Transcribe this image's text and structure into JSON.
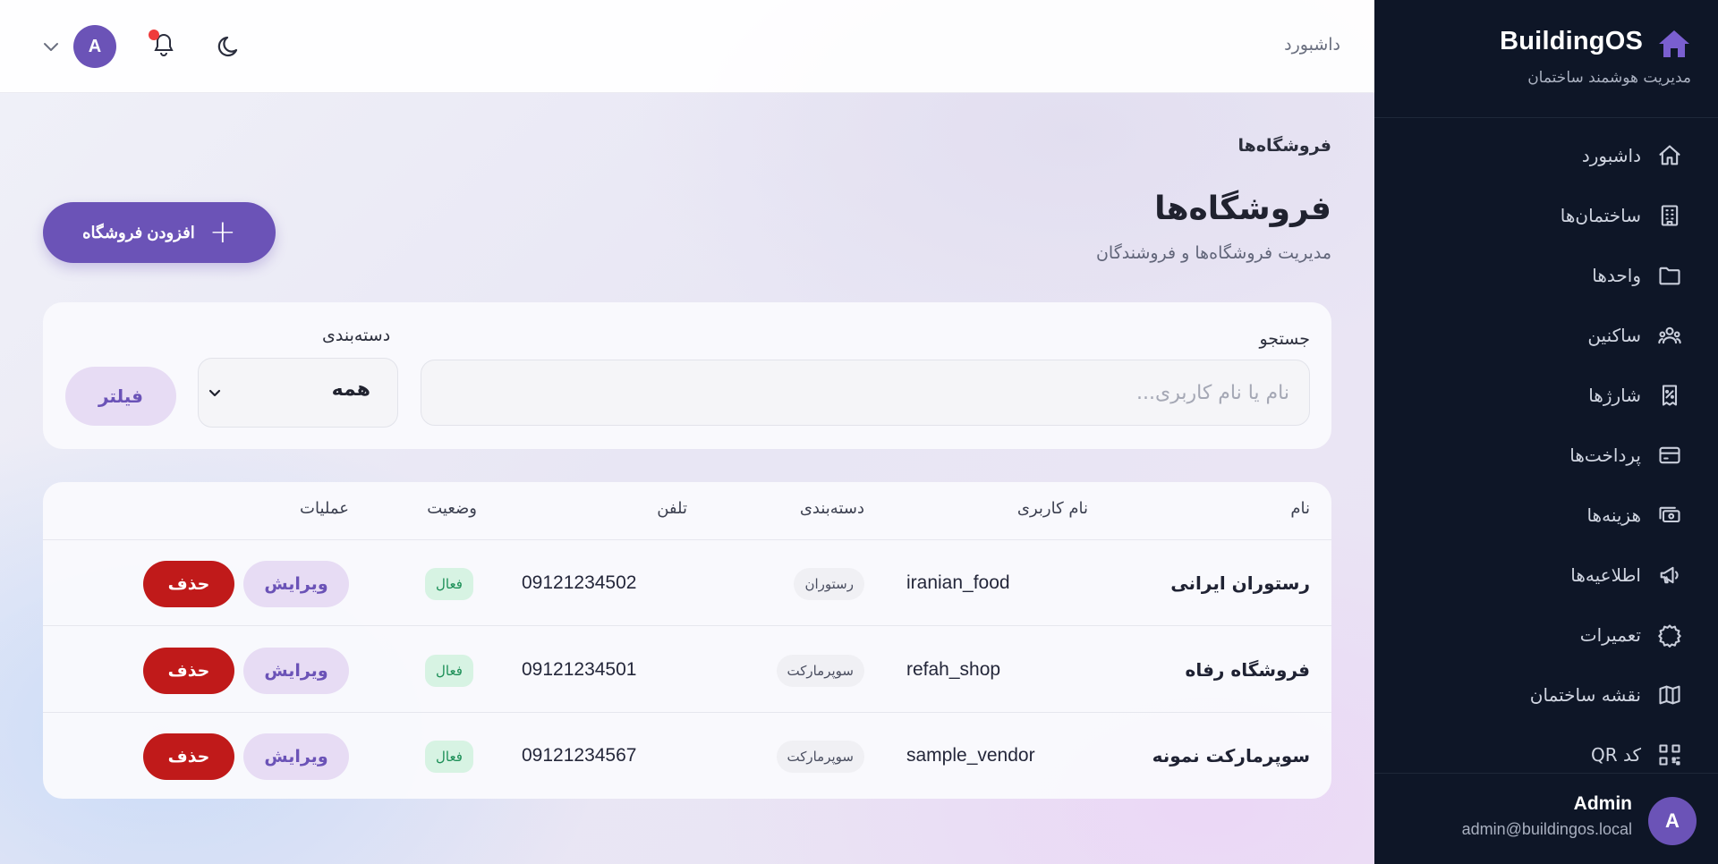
{
  "sidebar": {
    "brand_title": "BuildingOS",
    "brand_subtitle": "مدیریت هوشمند ساختمان",
    "items": [
      {
        "label": "داشبورد",
        "icon": "home-icon"
      },
      {
        "label": "ساختمان‌ها",
        "icon": "building-icon"
      },
      {
        "label": "واحدها",
        "icon": "folder-icon"
      },
      {
        "label": "ساکنین",
        "icon": "users-icon"
      },
      {
        "label": "شارژها",
        "icon": "receipt-icon"
      },
      {
        "label": "پرداخت‌ها",
        "icon": "credit-card-icon"
      },
      {
        "label": "هزینه‌ها",
        "icon": "cash-icon"
      },
      {
        "label": "اطلاعیه‌ها",
        "icon": "megaphone-icon"
      },
      {
        "label": "تعمیرات",
        "icon": "wrench-icon"
      },
      {
        "label": "نقشه ساختمان",
        "icon": "map-icon"
      },
      {
        "label": "کد QR",
        "icon": "qr-code-icon"
      }
    ],
    "user": {
      "avatar_letter": "A",
      "name": "Admin",
      "email": "admin@buildingos.local"
    }
  },
  "topbar": {
    "title": "داشبورد",
    "avatar_letter": "A"
  },
  "page": {
    "breadcrumb": "فروشگاه‌ها",
    "title": "فروشگاه‌ها",
    "subtitle": "مدیریت فروشگاه‌ها و فروشندگان",
    "add_button_label": "افزودن فروشگاه"
  },
  "filters": {
    "search_label": "جستجو",
    "search_placeholder": "نام یا نام کاربری...",
    "search_value": "",
    "category_label": "دسته‌بندی",
    "category_selected": "همه",
    "filter_button_label": "فیلتر"
  },
  "table": {
    "columns": {
      "name": "نام",
      "username": "نام کاربری",
      "category": "دسته‌بندی",
      "phone": "تلفن",
      "status": "وضعیت",
      "actions": "عملیات"
    },
    "rows": [
      {
        "name": "رستوران ایرانی",
        "username": "iranian_food",
        "category": "رستوران",
        "phone": "09121234502",
        "status": "فعال",
        "edit_label": "ویرایش",
        "delete_label": "حذف"
      },
      {
        "name": "فروشگاه رفاه",
        "username": "refah_shop",
        "category": "سوپرمارکت",
        "phone": "09121234501",
        "status": "فعال",
        "edit_label": "ویرایش",
        "delete_label": "حذف"
      },
      {
        "name": "سوپرمارکت نمونه",
        "username": "sample_vendor",
        "category": "سوپرمارکت",
        "phone": "09121234567",
        "status": "فعال",
        "edit_label": "ویرایش",
        "delete_label": "حذف"
      }
    ]
  },
  "colors": {
    "sidebar_bg": "#0e1627",
    "accent": "#6b53b7",
    "accent_soft": "#e7dcf4",
    "danger": "#c01a1a",
    "success_bg": "#d7f3e3",
    "success_text": "#1c8f57",
    "notification_dot": "#ef3b3b"
  }
}
